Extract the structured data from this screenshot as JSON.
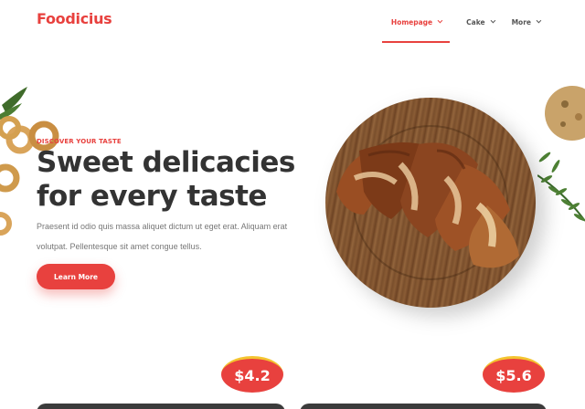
{
  "header": {
    "brand": "Foodicius",
    "nav": [
      {
        "label": "Homepage",
        "active": true
      },
      {
        "label": "Cake",
        "active": false
      },
      {
        "label": "More",
        "active": false
      }
    ]
  },
  "hero": {
    "eyebrow": "DISCOVER YOUR TASTE",
    "title_line1": "Sweet delicacies",
    "title_line2": "for every taste",
    "text": "Praesent id odio quis massa aliquet dictum ut eget erat. Aliquam erat volutpat. Pellentesque sit amet congue tellus.",
    "cta": "Learn More"
  },
  "products": [
    {
      "price": "$4.2"
    },
    {
      "price": "$5.6"
    }
  ],
  "colors": {
    "accent": "#e8413e",
    "text": "#333333",
    "muted": "#777777",
    "badge_border": "#f4c430"
  },
  "icons": {
    "nav_dropdown": "chevron-down-icon"
  }
}
